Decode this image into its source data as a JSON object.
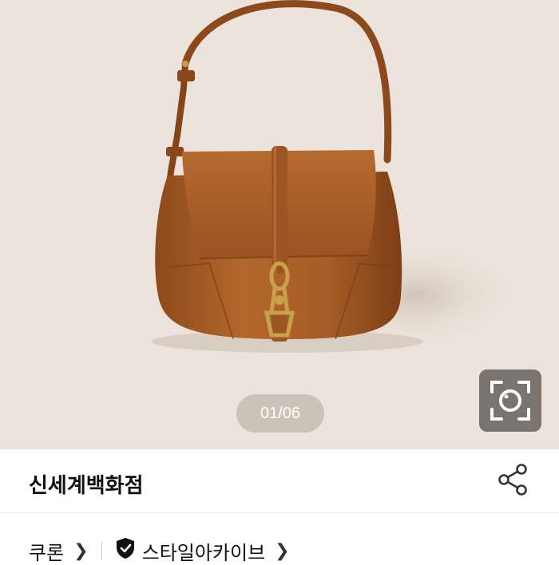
{
  "gallery": {
    "counter": "01/06",
    "background": "#ece4dc",
    "product_color": "#a45a22",
    "hardware_color": "#c8a24a"
  },
  "store": {
    "name": "신세계백화점"
  },
  "breadcrumb": {
    "items": [
      {
        "label": "쿠론",
        "icon": ""
      },
      {
        "label": "스타일아카이브",
        "icon": "verified-shield-icon"
      }
    ]
  },
  "icons": {
    "lens": "camera-lens-icon",
    "share": "share-icon",
    "chevron": "chevron-right-icon"
  }
}
